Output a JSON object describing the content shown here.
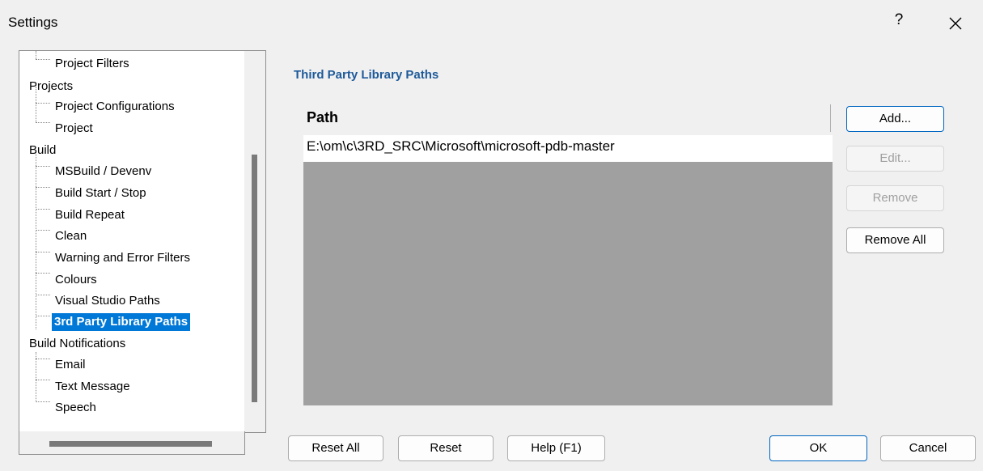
{
  "window": {
    "title": "Settings",
    "help_label": "?"
  },
  "tree": {
    "items": [
      {
        "label": "Project Filters",
        "level": "child"
      },
      {
        "label": "Projects",
        "level": "root"
      },
      {
        "label": "Project Configurations",
        "level": "child"
      },
      {
        "label": "Project",
        "level": "child"
      },
      {
        "label": "Build",
        "level": "root"
      },
      {
        "label": "MSBuild / Devenv",
        "level": "child"
      },
      {
        "label": "Build Start / Stop",
        "level": "child"
      },
      {
        "label": "Build Repeat",
        "level": "child"
      },
      {
        "label": "Clean",
        "level": "child"
      },
      {
        "label": "Warning and Error Filters",
        "level": "child"
      },
      {
        "label": "Colours",
        "level": "child"
      },
      {
        "label": "Visual Studio Paths",
        "level": "child"
      },
      {
        "label": "3rd Party Library Paths",
        "level": "child",
        "selected": true
      },
      {
        "label": "Build Notifications",
        "level": "root"
      },
      {
        "label": "Email",
        "level": "child"
      },
      {
        "label": "Text Message",
        "level": "child"
      },
      {
        "label": "Speech",
        "level": "child"
      }
    ]
  },
  "panel": {
    "title": "Third Party Library Paths",
    "list": {
      "header": "Path",
      "rows": [
        "E:\\om\\c\\3RD_SRC\\Microsoft\\microsoft-pdb-master"
      ]
    },
    "buttons": {
      "add": "Add...",
      "edit": "Edit...",
      "remove": "Remove",
      "remove_all": "Remove All"
    }
  },
  "footer": {
    "reset_all": "Reset All",
    "reset": "Reset",
    "help": "Help (F1)",
    "ok": "OK",
    "cancel": "Cancel"
  },
  "colors": {
    "selection": "#0078d7",
    "section_title": "#1e5a9a",
    "list_empty": "#a0a0a0"
  }
}
